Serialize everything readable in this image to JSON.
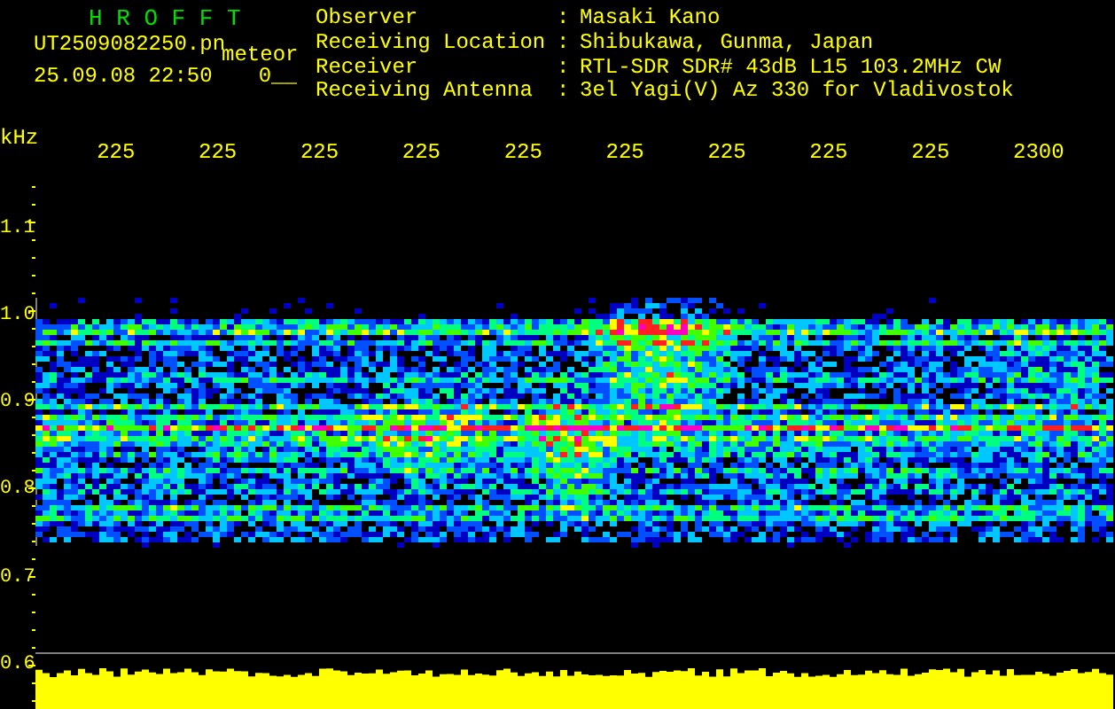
{
  "title": "H R O F F T",
  "file": {
    "name": "UT2509082250.pn",
    "tag": "meteor",
    "datetime": "25.09.08 22:50",
    "count": "0__"
  },
  "info": [
    {
      "label": "Observer",
      "separator": ":",
      "value": "Masaki Kano"
    },
    {
      "label": "Receiving Location",
      "separator": ":",
      "value": "Shibukawa, Gunma, Japan"
    },
    {
      "label": "Receiver",
      "separator": ":",
      "value": "RTL-SDR SDR# 43dB L15 103.2MHz CW"
    },
    {
      "label": "Receiving Antenna",
      "separator": ":",
      "value": "3el Yagi(V) Az 330 for Vladivostok"
    }
  ],
  "time_axis": {
    "labels": [
      "225",
      "225",
      "225",
      "225",
      "225",
      "225",
      "225",
      "225",
      "225",
      "2300"
    ]
  },
  "frequency_axis": {
    "unit": "kHz",
    "labels": [
      "1.1",
      "1.0",
      "0.9",
      "0.8",
      "0.7",
      "0.6"
    ]
  }
}
